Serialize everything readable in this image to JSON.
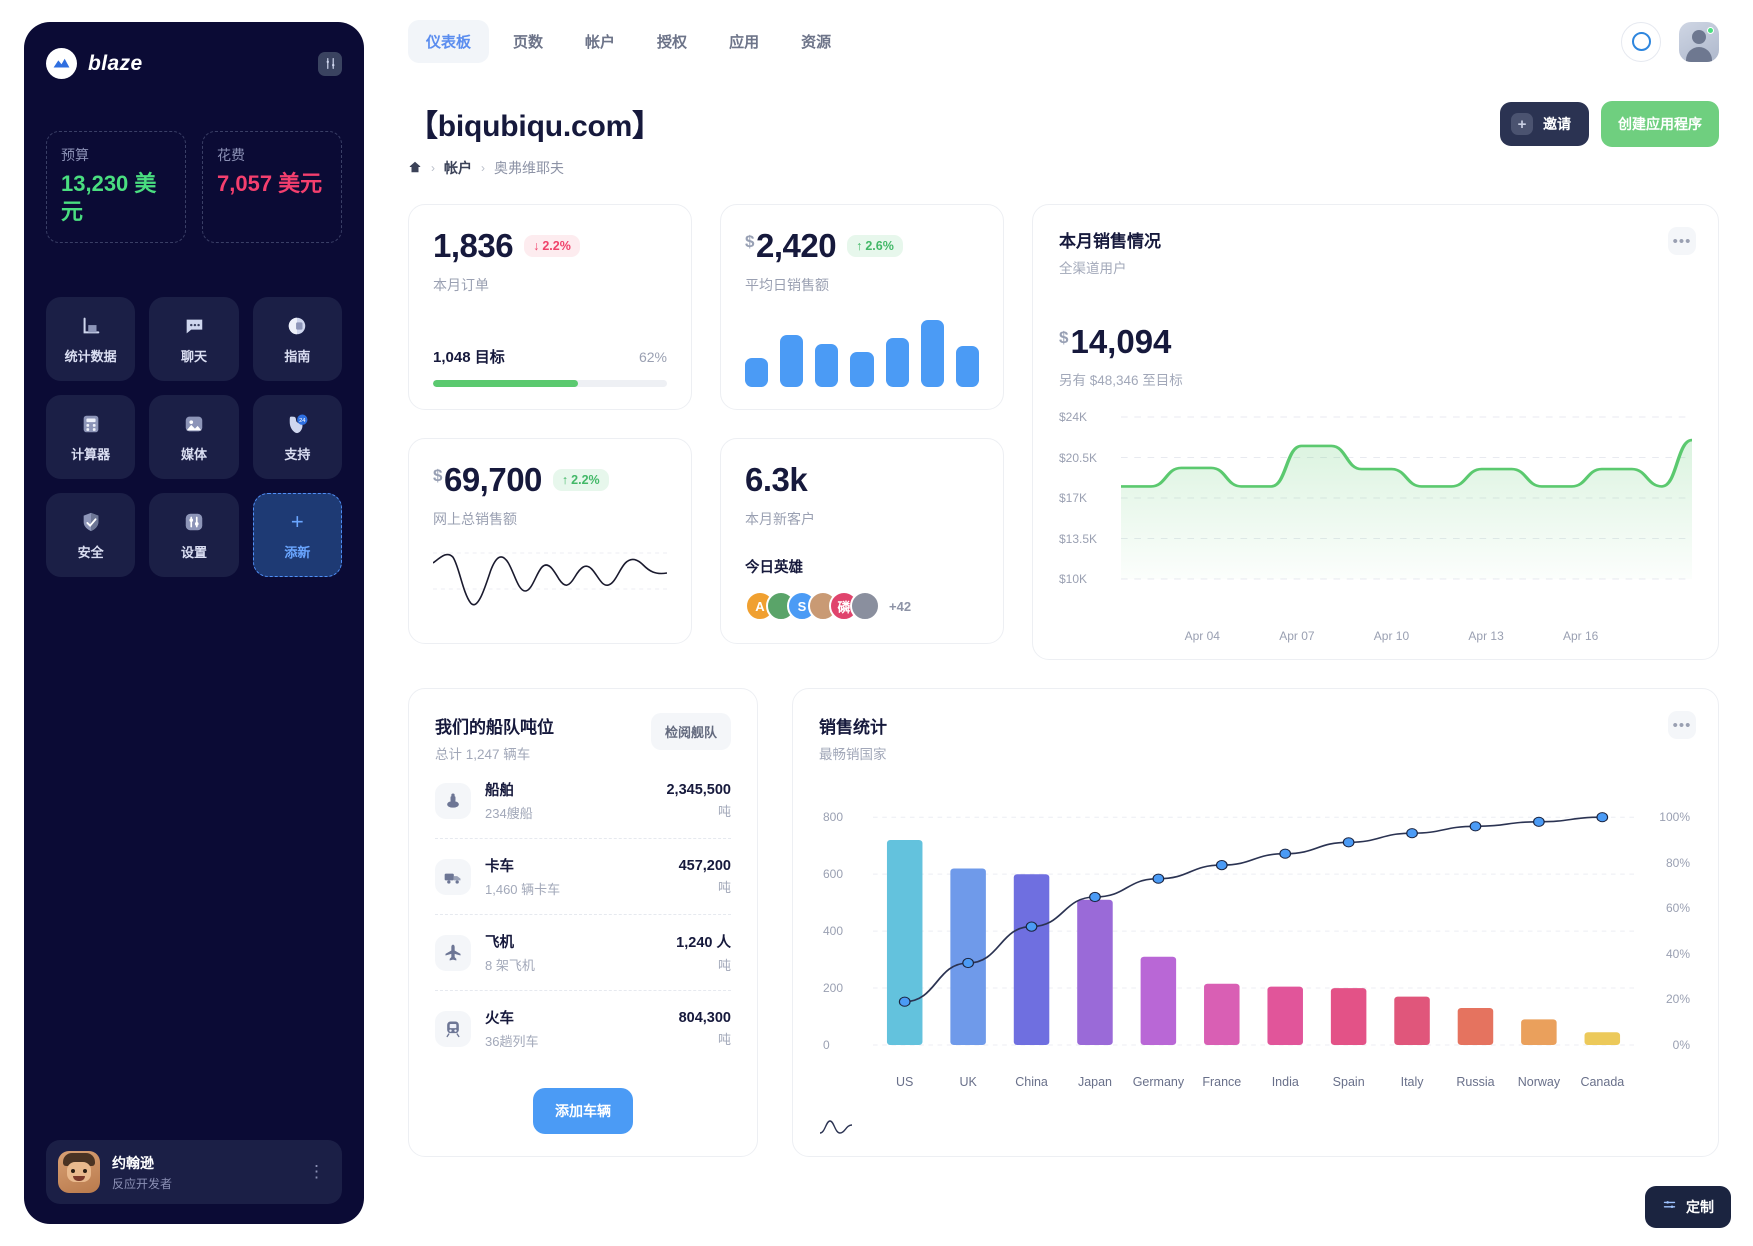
{
  "sidebar": {
    "brand": "blaze",
    "settings_icon": "sliders-icon",
    "budget": [
      {
        "label": "预算",
        "value": "13,230 美元",
        "color": "#4ade80"
      },
      {
        "label": "花费",
        "value": "7,057 美元",
        "color": "#f43f6e"
      }
    ],
    "tiles": [
      {
        "label": "统计数据",
        "icon": "bar-chart-icon"
      },
      {
        "label": "聊天",
        "icon": "chat-bubble-icon"
      },
      {
        "label": "指南",
        "icon": "book-icon"
      },
      {
        "label": "计算器",
        "icon": "calculator-icon"
      },
      {
        "label": "媒体",
        "icon": "image-icon"
      },
      {
        "label": "支持",
        "icon": "phone-24-icon"
      },
      {
        "label": "安全",
        "icon": "shield-icon"
      },
      {
        "label": "设置",
        "icon": "sliders-icon"
      },
      {
        "label": "添新",
        "icon": "plus-icon"
      }
    ],
    "profile": {
      "name": "约翰逊",
      "role": "反应开发者",
      "menu_icon": "kebab-vertical-icon"
    }
  },
  "header": {
    "tabs": [
      {
        "label": "仪表板",
        "active": true
      },
      {
        "label": "页数",
        "active": false
      },
      {
        "label": "帐户",
        "active": false
      },
      {
        "label": "授权",
        "active": false
      },
      {
        "label": "应用",
        "active": false
      },
      {
        "label": "资源",
        "active": false
      }
    ],
    "search_icon": "circle-icon",
    "account_avatar": "user-avatar"
  },
  "page": {
    "title": "【biqubiqu.com】",
    "breadcrumb": {
      "home_icon": "home-icon",
      "items": [
        "帐户",
        "奥弗维耶夫"
      ]
    },
    "invite_button": "邀请",
    "create_button": "创建应用程序"
  },
  "kpi": {
    "orders": {
      "value": "1,836",
      "delta": "2.2%",
      "delta_dir": "down",
      "subtitle": "本月订单",
      "goal": "1,048 目标",
      "percent": "62%",
      "progress": 62
    },
    "daily_sales": {
      "currency": "$",
      "value": "2,420",
      "delta": "2.6%",
      "delta_dir": "up",
      "subtitle": "平均日销售额",
      "bars": [
        42,
        75,
        62,
        50,
        70,
        96,
        58
      ]
    },
    "total_online": {
      "currency": "$",
      "value": "69,700",
      "delta": "2.2%",
      "delta_dir": "up",
      "subtitle": "网上总销售额"
    },
    "new_customers": {
      "value": "6.3k",
      "subtitle": "本月新客户",
      "heroes_title": "今日英雄",
      "heroes": [
        {
          "initial": "A",
          "color": "#f0a030"
        },
        {
          "initial": "",
          "color": "#5aa469"
        },
        {
          "initial": "S",
          "color": "#4b9bf5"
        },
        {
          "initial": "",
          "color": "#c99a74"
        },
        {
          "initial": "磷",
          "color": "#e0446d"
        },
        {
          "initial": "",
          "color": "#8a8f9e"
        }
      ],
      "more": "+42"
    }
  },
  "sales_panel": {
    "title": "本月销售情况",
    "subtitle": "全渠道用户",
    "currency": "$",
    "amount": "14,094",
    "goal_note": "另有 $48,346 至目标",
    "menu_icon": "kebab-icon"
  },
  "fleet": {
    "title": "我们的船队吨位",
    "subtitle": "总计 1,247 辆车",
    "review_button": "检阅舰队",
    "rows": [
      {
        "name": "船舶",
        "meta": "234艘船",
        "value": "2,345,500",
        "unit": "吨",
        "icon": "ship-icon"
      },
      {
        "name": "卡车",
        "meta": "1,460 辆卡车",
        "value": "457,200",
        "unit": "吨",
        "icon": "truck-icon"
      },
      {
        "name": "飞机",
        "meta": "8 架飞机",
        "value": "1,240 人",
        "unit": "吨",
        "icon": "plane-icon"
      },
      {
        "name": "火车",
        "meta": "36趟列车",
        "value": "804,300",
        "unit": "吨",
        "icon": "train-icon"
      }
    ],
    "add_button": "添加车辆"
  },
  "pareto_panel": {
    "title": "销售统计",
    "subtitle": "最畅销国家",
    "menu_icon": "kebab-icon",
    "footer_icon": "wave-icon"
  },
  "customize": {
    "label": "定制",
    "icon": "sliders-icon"
  },
  "chart_data": [
    {
      "type": "area",
      "title": "本月销售情况",
      "xlabel": "",
      "ylabel": "",
      "ylim": [
        10000,
        24000
      ],
      "ytick_labels": [
        "$24K",
        "$20.5K",
        "$17K",
        "$13.5K",
        "$10K"
      ],
      "ytick_values": [
        24000,
        20500,
        17000,
        13500,
        10000
      ],
      "xtick_labels": [
        "Apr 04",
        "Apr 07",
        "Apr 10",
        "Apr 13",
        "Apr 16"
      ],
      "grid": true,
      "legend": "none",
      "line_color": "#5bc96f",
      "values": [
        18000,
        18000,
        19600,
        19600,
        18000,
        18000,
        21500,
        21500,
        19500,
        19500,
        18000,
        18000,
        19500,
        19500,
        18000,
        18000,
        19500,
        19500,
        18000,
        22000
      ]
    },
    {
      "type": "bar",
      "title": "销售统计",
      "subtitle": "最畅销国家",
      "categories": [
        "US",
        "UK",
        "China",
        "Japan",
        "Germany",
        "France",
        "India",
        "Spain",
        "Italy",
        "Russia",
        "Norway",
        "Canada"
      ],
      "values": [
        720,
        620,
        600,
        510,
        310,
        215,
        205,
        200,
        170,
        130,
        90,
        45
      ],
      "bar_colors": [
        "#63c2dd",
        "#6f9aea",
        "#6f6fe0",
        "#9a6ad8",
        "#b967d6",
        "#d95fb4",
        "#e1559a",
        "#e35287",
        "#e0567b",
        "#e5735f",
        "#eaa05c",
        "#ecc95a"
      ],
      "ylabel": "",
      "ylim": [
        0,
        850
      ],
      "ytick_labels": [
        "0",
        "200",
        "400",
        "600",
        "800"
      ],
      "ytick_values": [
        0,
        200,
        400,
        600,
        800
      ],
      "secondary_axis": {
        "name": "cumulative",
        "ytick_labels": [
          "0%",
          "20%",
          "40%",
          "60%",
          "80%",
          "100%"
        ],
        "ytick_values": [
          0,
          20,
          40,
          60,
          80,
          100
        ],
        "values": [
          19,
          36,
          52,
          65,
          73,
          79,
          84,
          89,
          93,
          96,
          98,
          100
        ],
        "line_color": "#2b3352",
        "marker_color": "#4b9bf5"
      },
      "grid": true,
      "legend": "none"
    }
  ]
}
